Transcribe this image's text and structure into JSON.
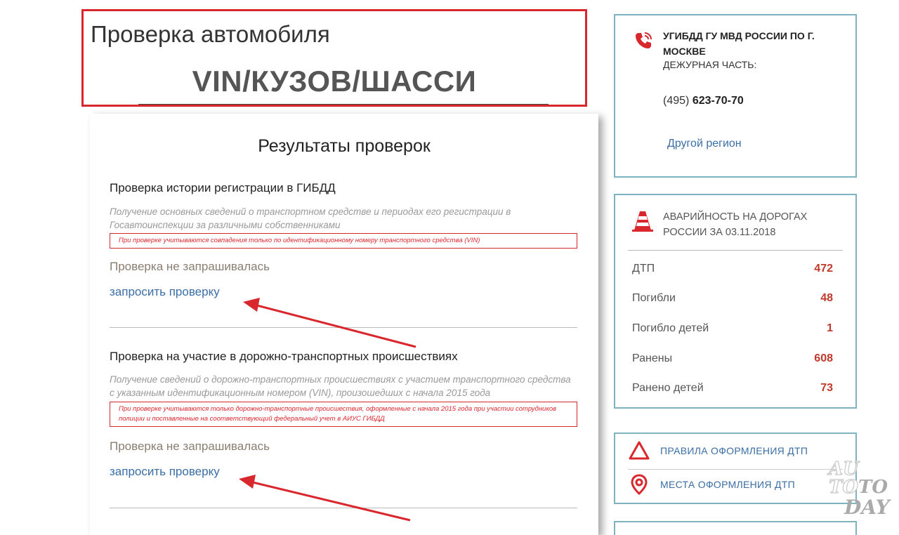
{
  "header": {
    "title": "Проверка автомобиля",
    "subtitle": "VIN/КУЗОВ/ШАССИ"
  },
  "results": {
    "title": "Результаты проверок",
    "sections": [
      {
        "title": "Проверка истории регистрации в ГИБДД",
        "description": "Получение основных сведений о транспортном средстве и периодах его регистрации в Госавтоинспекции за различными собственниками",
        "note": "При проверке учитываются совпадения только по идентификационному номеру транспортного средства (VIN)",
        "status": "Проверка не запрашивалась",
        "link": "запросить проверку"
      },
      {
        "title": "Проверка на участие в дорожно-транспортных происшествиях",
        "description": "Получение сведений о дорожно-транспортных происшествиях с участием транспортного средства с указанным идентификационным номером (VIN), произошедших с начала 2015 года",
        "note": "При проверке учитываются только дорожно-транспортные происшествия, оформленные с начала 2015 года при участии сотрудников полиции и поставленные на соответствующий федеральный учет в АИУС ГИБДД",
        "status": "Проверка не запрашивалась",
        "link": "запросить проверку"
      }
    ]
  },
  "gibdd": {
    "name": "УГИБДД ГУ МВД РОССИИ ПО Г. МОСКВЕ",
    "duty": "ДЕЖУРНАЯ ЧАСТЬ:",
    "phone_code": "(495)",
    "phone_number": "623-70-70",
    "region_link": "Другой регион",
    "icon": "phone-icon"
  },
  "stats": {
    "title": "АВАРИЙНОСТЬ НА ДОРОГАХ РОССИИ ЗА 03.11.2018",
    "icon": "traffic-cone-icon",
    "rows": [
      {
        "label": "ДТП",
        "value": "472"
      },
      {
        "label": "Погибли",
        "value": "48"
      },
      {
        "label": "Погибло детей",
        "value": "1"
      },
      {
        "label": "Ранены",
        "value": "608"
      },
      {
        "label": "Ранено детей",
        "value": "73"
      }
    ]
  },
  "links": [
    {
      "label": "ПРАВИЛА ОФОРМЛЕНИЯ ДТП",
      "icon": "warning-triangle-icon"
    },
    {
      "label": "МЕСТА ОФОРМЛЕНИЯ ДТП",
      "icon": "map-pin-icon"
    }
  ],
  "watermark": {
    "line1": "AU",
    "line2": "TO",
    "line3": "TO",
    "line4": "DAY"
  },
  "colors": {
    "accent_red": "#d9272e",
    "link_blue": "#3a6ea5",
    "border_teal": "#7fb3c0",
    "stat_red": "#c0392b"
  }
}
